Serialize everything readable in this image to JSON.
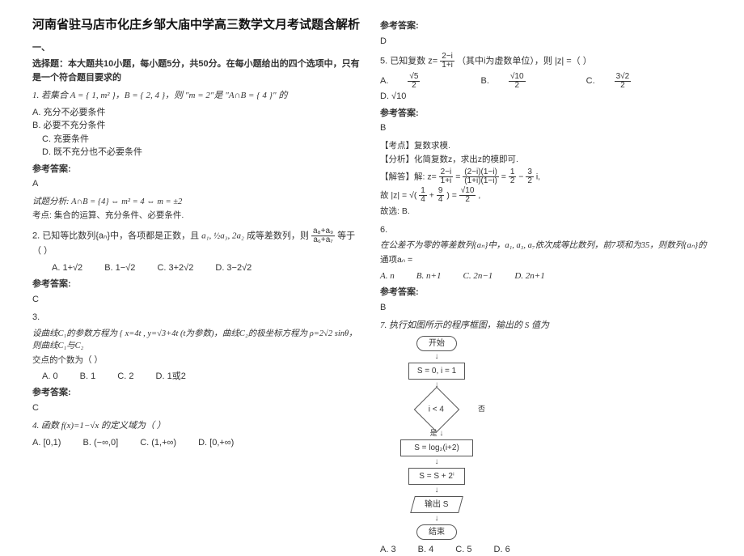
{
  "title": "河南省驻马店市化庄乡邹大庙中学高三数学文月考试题含解析",
  "sectionHead1": "一、",
  "sectionHead2": "选择题：本大题共10小题，每小题5分，共50分。在每小题给出的四个选项中，只有是一个符合题目要求的",
  "q1": {
    "stem": "1. 若集合 A = { 1, m² }，B = { 2, 4 }，则 \"m = 2\"是 \"A∩B = { 4 }\" 的",
    "optA": "A. 充分不必要条件",
    "optB": "B. 必要不充分条件",
    "optC": "C. 充要条件",
    "optD": "D. 既不充分也不必要条件",
    "ansLabel": "参考答案:",
    "ans": "A",
    "expl1": "试题分析: A∩B = {4} ⇔ m² = 4 ⇔ m = ±2",
    "expl2": "考点: 集合的运算、充分条件、必要条件."
  },
  "q2": {
    "stem_pre": "2. 已知等比数列{aₙ}中，各项都是正数，且 ",
    "stem_mid": "a₁, ½a₃, 2a₂",
    "stem_post": " 成等差数列，则 ",
    "frac_top": "a₈+a₉",
    "frac_bot": "a₆+a₇",
    "stem_end": " 等于（ ）",
    "optA": "A. 1+√2",
    "optB": "B. 1−√2",
    "optC": "C. 3+2√2",
    "optD": "D. 3−2√2",
    "ansLabel": "参考答案:",
    "ans": "C"
  },
  "q3": {
    "num": "3.",
    "stem": "设曲线C₁的参数方程为 { x=4t , y=√3+4t (t为参数)，曲线C₂的极坐标方程为 ρ=2√2 sinθ，则曲线C₁与C₂",
    "stem2": "交点的个数为（  ）",
    "optA": "A. 0",
    "optB": "B. 1",
    "optC": "C. 2",
    "optD": "D. 1或2",
    "ansLabel": "参考答案:",
    "ans": "C"
  },
  "q4": {
    "stem": "4. 函数 f(x)=1−√x 的定义域为（    ）",
    "optA": "A. [0,1)",
    "optB": "B. (−∞,0]",
    "optC": "C. (1,+∞)",
    "optD": "D. [0,+∞)",
    "ansLabel": "参考答案:",
    "ans": "D"
  },
  "q5": {
    "stem_pre": "5. 已知复数 z=",
    "frac_top": "2−i",
    "frac_bot": "1+i",
    "stem_post": "（其中i为虚数单位），则 |z| =（    ）",
    "optA_pre": "A. ",
    "optA_top": "√5",
    "optA_bot": "2",
    "optB_pre": "B. ",
    "optB_top": "√10",
    "optB_bot": "2",
    "optC_pre": "C. ",
    "optC_top": "3√2",
    "optC_bot": "2",
    "optD": "D. √10",
    "ansLabel": "参考答案:",
    "ans": "B",
    "kp": "【考点】复数求模.",
    "fx": "【分析】化简复数z，求出z的模即可.",
    "jd_pre": "【解答】解: z=",
    "jd_f1t": "2−i",
    "jd_f1b": "1+i",
    "jd_eq": "=",
    "jd_f2t": "(2−i)(1−i)",
    "jd_f2b": "(1+i)(1−i)",
    "jd_f3t": "1",
    "jd_f3b": "2",
    "jd_minus": "−",
    "jd_f4t": "3",
    "jd_f4b": "2",
    "jd_i": "i,",
    "jd2_pre": "故 |z| = √(",
    "jd2_t1": "1",
    "jd2_b1": "4",
    "jd2_plus": "+",
    "jd2_t2": "9",
    "jd2_b2": "4",
    "jd2_post": ") = ",
    "jd2_rt": "√10",
    "jd2_rb": "2",
    "jd2_end": ",",
    "concl": "故选: B."
  },
  "q6": {
    "num": "6.",
    "stem": "在公差不为零的等差数列{aₙ}中，a₁, a₃, a₇依次成等比数列，前7项和为35，则数列{aₙ}的",
    "stem2": "通项aₙ =",
    "optA": "A. n",
    "optB": "B. n+1",
    "optC": "C. 2n−1",
    "optD": "D. 2n+1",
    "ansLabel": "参考答案:",
    "ans": "B"
  },
  "q7": {
    "stem": "7. 执行如图所示的程序框图，输出的 S 值为",
    "flow": {
      "start": "开始",
      "init": "S = 0, i = 1",
      "cond": "i < 4",
      "yes": "是",
      "no": "否",
      "upd": "S = log₂(i+2)",
      "inc": "S = S + 2ⁱ",
      "out": "输出 S",
      "end": "结束"
    },
    "optA": "A. 3",
    "optB": "B. 4",
    "optC": "C. 5",
    "optD": "D. 6"
  }
}
